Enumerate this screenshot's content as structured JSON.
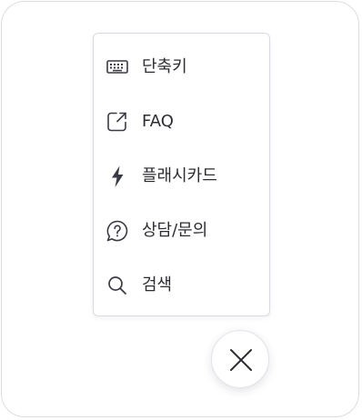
{
  "menu": {
    "items": [
      {
        "label": "단축키",
        "icon": "keyboard-icon"
      },
      {
        "label": "FAQ",
        "icon": "external-link-icon"
      },
      {
        "label": "플래시카드",
        "icon": "lightning-bolt-icon"
      },
      {
        "label": "상담/문의",
        "icon": "question-bubble-icon"
      },
      {
        "label": "검색",
        "icon": "search-icon"
      }
    ]
  },
  "close_button": {
    "icon": "close-icon"
  },
  "colors": {
    "text": "#2c2c33",
    "icon": "#3a3a44",
    "border": "#d9dae2",
    "panel_border": "#dcdce3"
  }
}
